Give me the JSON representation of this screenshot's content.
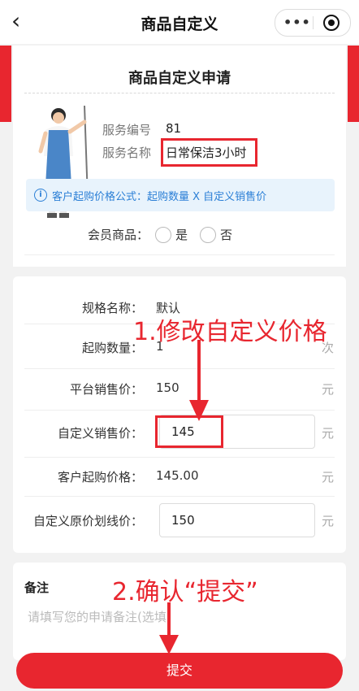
{
  "nav": {
    "back_glyph": "‹",
    "title": "商品自定义",
    "more_glyph": "•••"
  },
  "card1": {
    "title": "商品自定义申请",
    "service_no_label": "服务编号",
    "service_no_value": "81",
    "service_name_label": "服务名称",
    "service_name_value": "日常保洁3小时",
    "formula_text": "客户起购价格公式：起购数量 X 自定义销售价",
    "member_label": "会员商品：",
    "option_yes": "是",
    "option_no": "否"
  },
  "spec": {
    "name_label": "规格名称：",
    "name_value": "默认",
    "qty_label": "起购数量：",
    "qty_value": "1",
    "qty_unit": "次",
    "platform_label": "平台销售价：",
    "platform_value": "150",
    "platform_unit": "元",
    "custom_label": "自定义销售价：",
    "custom_value": "145",
    "custom_unit": "元",
    "client_label": "客户起购价格：",
    "client_value": "145.00",
    "client_unit": "元",
    "orig_label": "自定义原价划线价：",
    "orig_value": "150",
    "orig_unit": "元"
  },
  "annotations": {
    "step1": "1.修改自定义价格",
    "step2": "2.确认“提交”"
  },
  "remark": {
    "label": "备注",
    "placeholder": "请填写您的申请备注(选填)"
  },
  "submit_label": "提交",
  "colors": {
    "accent_red": "#e8262f",
    "info_blue": "#2b7fd6",
    "info_bg": "#e8f3fc",
    "page_bg": "#f2f2f2"
  },
  "icons": [
    "back-chevron-icon",
    "more-dots-icon",
    "target-icon",
    "info-icon",
    "cleaner-avatar-image"
  ]
}
